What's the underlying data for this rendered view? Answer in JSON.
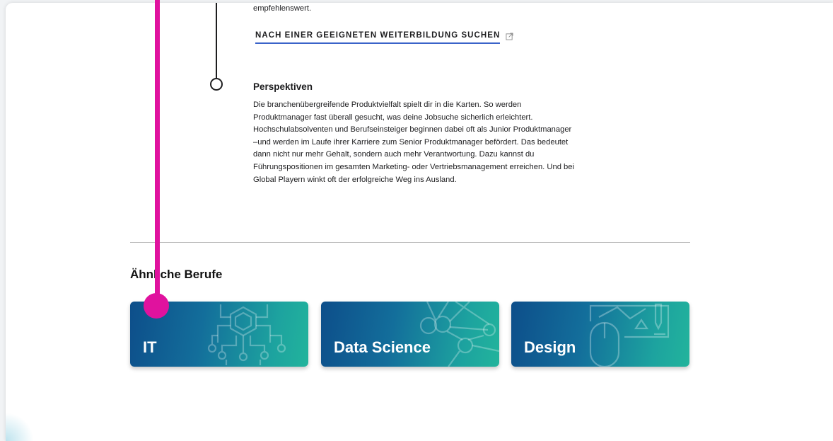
{
  "previous_section": {
    "tail_text": "empfehlenswert.",
    "search_link_label": "NACH EINER GEEIGNETEN WEITERBILDUNG SUCHEN",
    "search_link_icon": "external-link-icon"
  },
  "perspectives": {
    "title": "Perspektiven",
    "lines": [
      "Die branchenübergreifende Produktvielfalt spielt dir in die Karten. So werden",
      "Produktmanager fast überall gesucht, was deine Jobsuche sicherlich erleichtert.",
      "Hochschulabsolventen und Berufseinsteiger beginnen dabei oft als Junior Produktmanager",
      "–und werden im Laufe ihrer Karriere zum Senior Produktmanager befördert. Das bedeutet",
      "dann nicht nur mehr Gehalt, sondern auch mehr Verantwortung. Dazu kannst du",
      "Führungspositionen im gesamten Marketing- oder Vertriebsmanagement erreichen. Und bei",
      "Global Playern winkt oft der erfolgreiche Weg ins Ausland."
    ]
  },
  "related": {
    "title": "Ähnliche Berufe",
    "cards": [
      {
        "label": "IT",
        "icon": "circuit-chip-icon"
      },
      {
        "label": "Data Science",
        "icon": "network-nodes-icon"
      },
      {
        "label": "Design",
        "icon": "drawing-tablet-mouse-icon"
      }
    ]
  },
  "colors": {
    "accent_link_underline": "#3a63c9",
    "card_gradient_start": "#0d4e8a",
    "card_gradient_end": "#22b49c",
    "pointer_marker": "#e0129e"
  }
}
